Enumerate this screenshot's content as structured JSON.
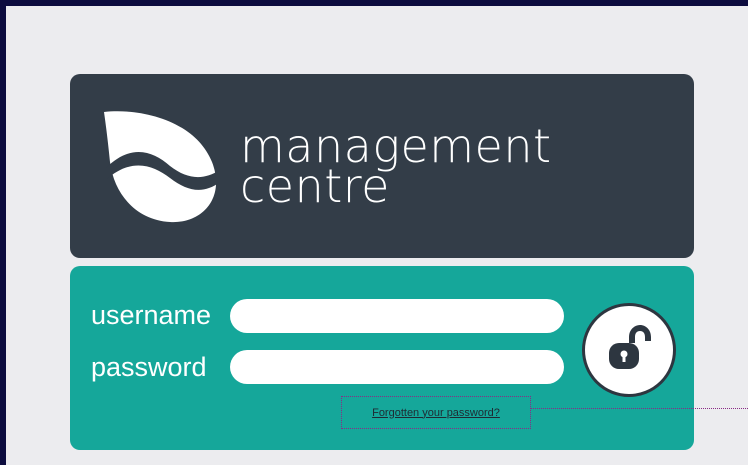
{
  "brand": {
    "line1": "management",
    "line2": "centre"
  },
  "login": {
    "username_label": "username",
    "password_label": "password",
    "username_value": "",
    "password_value": "",
    "forgot_link": "Forgotten your password?"
  },
  "icons": {
    "logo": "leaf-wave-logo-icon",
    "login_button": "unlocked-padlock-icon"
  },
  "colors": {
    "outer_frame": "#0d0c3f",
    "background": "#ececef",
    "header_panel": "#333d48",
    "login_panel": "#15a79a",
    "annotation": "#8a2a86"
  }
}
